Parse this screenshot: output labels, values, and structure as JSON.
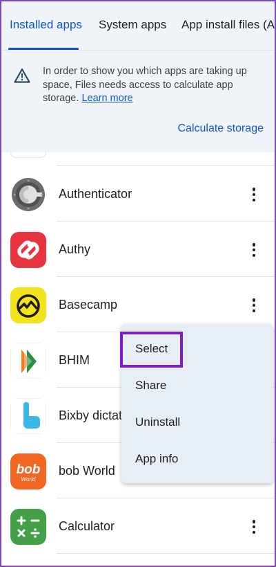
{
  "tabs": [
    {
      "label": "Installed apps",
      "active": true
    },
    {
      "label": "System apps",
      "active": false
    },
    {
      "label": "App install files (AP",
      "active": false
    }
  ],
  "banner": {
    "text": "In order to show you which apps are taking up space, Files needs access to calculate app storage.",
    "learn_more": "Learn more",
    "action": "Calculate storage"
  },
  "apps": [
    {
      "name": "Authenticator",
      "icon": "authenticator-icon"
    },
    {
      "name": "Authy",
      "icon": "authy-icon"
    },
    {
      "name": "Basecamp",
      "icon": "basecamp-icon"
    },
    {
      "name": "BHIM",
      "icon": "bhim-icon"
    },
    {
      "name": "Bixby dictat",
      "icon": "bixby-dictation-icon"
    },
    {
      "name": "bob World",
      "icon": "bob-world-icon",
      "logo_text": "bob",
      "logo_sub": "World"
    },
    {
      "name": "Calculator",
      "icon": "calculator-icon"
    }
  ],
  "menu": {
    "items": [
      "Select",
      "Share",
      "Uninstall",
      "App info"
    ]
  },
  "colors": {
    "accent": "#0b57d0",
    "highlight": "#7d1ad6",
    "banner_bg": "#f0f4f9",
    "menu_bg": "#e8eef6"
  }
}
